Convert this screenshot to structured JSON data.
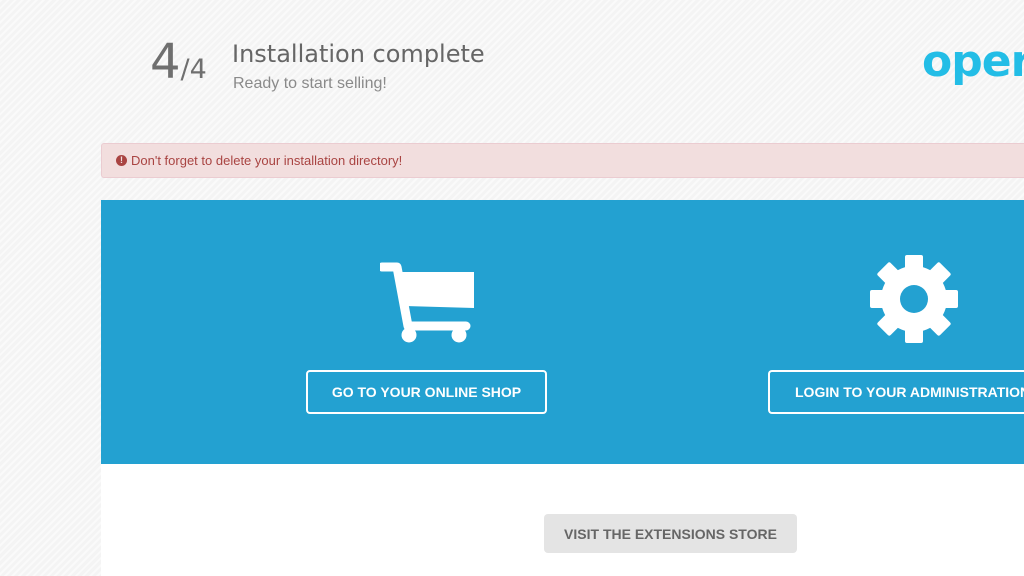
{
  "header": {
    "step_current": "4",
    "step_separator_total": "/4",
    "title": "Installation complete",
    "subtitle": "Ready to start selling!",
    "logo_text": "oper"
  },
  "alert": {
    "icon": "exclamation-circle-icon",
    "icon_glyph": "!",
    "message": "Don't forget to delete your installation directory!"
  },
  "actions": {
    "shop_icon": "shopping-cart-icon",
    "shop_button_label": "GO TO YOUR ONLINE SHOP",
    "admin_icon": "gear-icon",
    "admin_button_label": "LOGIN TO YOUR ADMINISTRATION"
  },
  "extensions": {
    "button_label": "VISIT THE EXTENSIONS STORE"
  },
  "colors": {
    "primary_blue": "#23a1d1",
    "logo_blue": "#23bde6",
    "alert_background": "#f2dede",
    "alert_text": "#a94442"
  }
}
